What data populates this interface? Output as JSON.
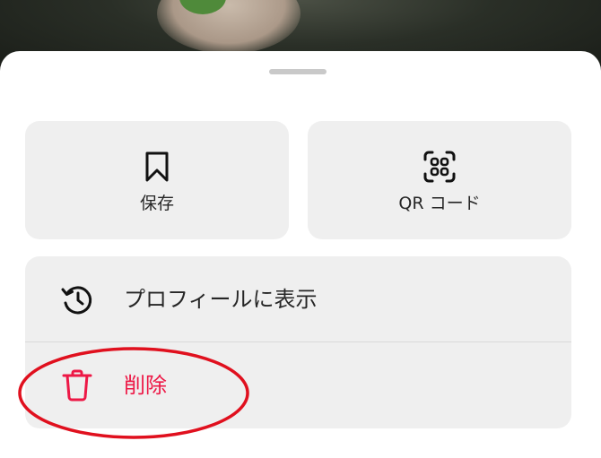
{
  "sheet": {
    "tiles": [
      {
        "label": "保存",
        "icon": "bookmark-icon"
      },
      {
        "label": "QR コード",
        "icon": "qr-code-icon"
      }
    ],
    "list": [
      {
        "label": "プロフィールに表示",
        "icon": "history-icon"
      },
      {
        "label": "削除",
        "icon": "trash-icon",
        "color": "#ed1846"
      }
    ]
  },
  "annotation": {
    "color": "#e0101e"
  }
}
